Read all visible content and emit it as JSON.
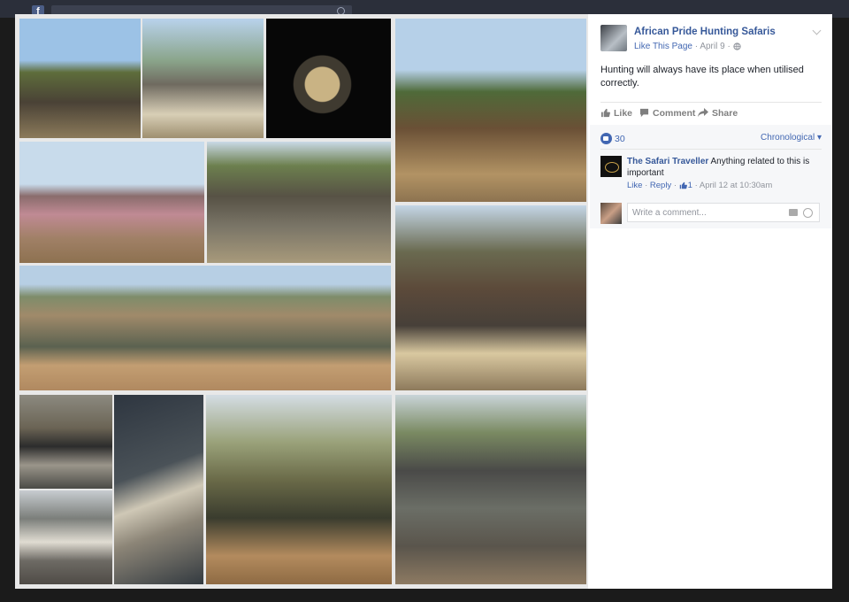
{
  "background": {
    "fb_letter": "f"
  },
  "photos": [
    {
      "name": "photo-hunter-with-elephant",
      "bg": "linear-gradient(180deg,#9cc2e6 0%,#9cc2e6 35%,#5e6d3b 45%,#4a4236 70%,#8b7a5a 100%)"
    },
    {
      "name": "photo-elephant-tusks",
      "bg": "linear-gradient(180deg,#b9d2ec 0%,#8aa58b 35%,#6f6a60 55%,#d8cfb6 80%,#9e8f70 100%)"
    },
    {
      "name": "photo-hunter-with-leopard",
      "bg": "radial-gradient(circle at 45% 55%,#c9b384 0 18%,#3f3a30 19% 30%,#070707 31% 100%)"
    },
    {
      "name": "photo-hunters-with-sable",
      "bg": "linear-gradient(180deg,#b6d0e8 0%,#b6d0e8 28%,#4f6a39 40%,#6a5036 60%,#b29364 85%,#8d7350 100%)"
    },
    {
      "name": "photo-woman-with-hippo",
      "bg": "linear-gradient(180deg,#c8dbeb 0%,#c8dbeb 35%,#8a6c6c 45%,#c08a94 60%,#a08066 80%,#8d7150 100%)"
    },
    {
      "name": "photo-group-with-elephant",
      "bg": "linear-gradient(180deg,#c9d9e6 0%,#6c7f4e 20%,#575245 45%,#7a7567 70%,#a89a7b 100%)"
    },
    {
      "name": "photo-hunter-with-crocodile",
      "bg": "linear-gradient(180deg,#b7cfe4 0%,#b7cfe4 15%,#7e8c6a 25%,#a08a6a 40%,#5b6250 65%,#c39e72 80%,#b08960 100%)"
    },
    {
      "name": "photo-hunters-with-elephant-head",
      "bg": "linear-gradient(180deg,#c4d6e6 0%,#6a6a50 25%,#5c4a3a 45%,#474039 65%,#d9c8a0 80%,#8d7a5c 100%)"
    },
    {
      "name": "photo-rifle-closeup",
      "bg": "linear-gradient(180deg,#8c8a80 0%,#6b6455 35%,#2c2c2c 55%,#9a958a 75%,#4a4a46 100%)"
    },
    {
      "name": "photo-horn-closeup",
      "bg": "linear-gradient(160deg,#2e3640 0%,#4a5258 40%,#cfc8b6 55%,#8c8577 70%,#333a40 100%)"
    },
    {
      "name": "photo-tusk-closeup",
      "bg": "linear-gradient(180deg,#c7ccd0 0%,#7b7e7a 30%,#e0dcd2 55%,#6d6a64 75%,#4f4b46 100%)"
    },
    {
      "name": "photo-hunter-with-buffalo",
      "bg": "linear-gradient(180deg,#d4dde4 0%,#9aa27a 25%,#6a6a48 45%,#3a3c2e 65%,#b38b5e 85%,#8e6a43 100%)"
    },
    {
      "name": "photo-hunter-with-buffalo-2",
      "bg": "linear-gradient(180deg,#c9d4d8 0%,#7a8a62 20%,#4a4a48 40%,#6b6e66 60%,#5a554c 80%,#8d7a62 100%)"
    }
  ],
  "post": {
    "page_name": "African Pride Hunting Safaris",
    "like_page": "Like This Page",
    "separator": "·",
    "date": "April 9",
    "audience_icon": "globe-icon",
    "body": "Hunting will always have its place when utilised correctly.",
    "actions": {
      "like": "Like",
      "comment": "Comment",
      "share": "Share"
    }
  },
  "reactions": {
    "count": "30",
    "sort": "Chronological"
  },
  "comment": {
    "author": "The Safari Traveller",
    "text": "Anything related to this is important",
    "like": "Like",
    "reply": "Reply",
    "likes_count": "1",
    "time": "April 12 at 10:30am"
  },
  "write_comment": {
    "placeholder": "Write a comment..."
  },
  "colors": {
    "link": "#365899",
    "accent": "#4267b2",
    "muted": "#90949c"
  }
}
